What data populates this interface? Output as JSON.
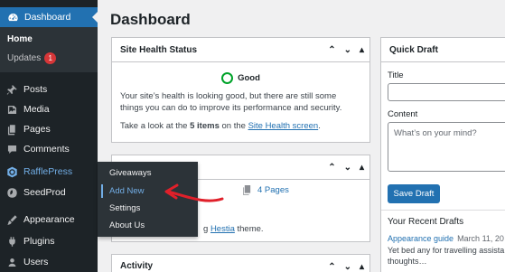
{
  "sidebar": {
    "dashboard_label": "Dashboard",
    "submenu": {
      "home": "Home",
      "updates": "Updates",
      "updates_count": "1"
    },
    "items": [
      {
        "label": "Posts",
        "icon": "pin-icon"
      },
      {
        "label": "Media",
        "icon": "media-icon"
      },
      {
        "label": "Pages",
        "icon": "pages-icon"
      },
      {
        "label": "Comments",
        "icon": "comment-icon"
      },
      {
        "label": "RafflePress",
        "icon": "rafflepress-icon"
      },
      {
        "label": "SeedProd",
        "icon": "seedprod-icon"
      },
      {
        "label": "Appearance",
        "icon": "brush-icon"
      },
      {
        "label": "Plugins",
        "icon": "plugin-icon"
      },
      {
        "label": "Users",
        "icon": "users-icon"
      }
    ]
  },
  "flyout": {
    "items": [
      "Giveaways",
      "Add New",
      "Settings",
      "About Us"
    ]
  },
  "main": {
    "title": "Dashboard",
    "site_health": {
      "title": "Site Health Status",
      "status": "Good",
      "message": "Your site’s health is looking good, but there are still some things you can do to improve its performance and security.",
      "items_pre": "Take a look at the ",
      "items_bold": "5 items",
      "items_mid": " on the ",
      "items_link": "Site Health screen",
      "items_post": "."
    },
    "glance": {
      "pages": "4 Pages",
      "theme_pre": "g ",
      "theme_link": "Hestia",
      "theme_post": " theme."
    },
    "activity": {
      "title": "Activity"
    },
    "quick_draft": {
      "title": "Quick Draft",
      "title_label": "Title",
      "content_label": "Content",
      "content_placeholder": "What’s on your mind?",
      "save_button": "Save Draft",
      "recent_title": "Your Recent Drafts",
      "draft_title": "Appearance guide",
      "draft_date": "March 11, 20",
      "draft_excerpt_1": "Yet bed any for travelling assista",
      "draft_excerpt_2": "thoughts…"
    }
  },
  "colors": {
    "accent": "#2271b1",
    "sidebar": "#1d2327",
    "annotation": "#e0202a"
  }
}
